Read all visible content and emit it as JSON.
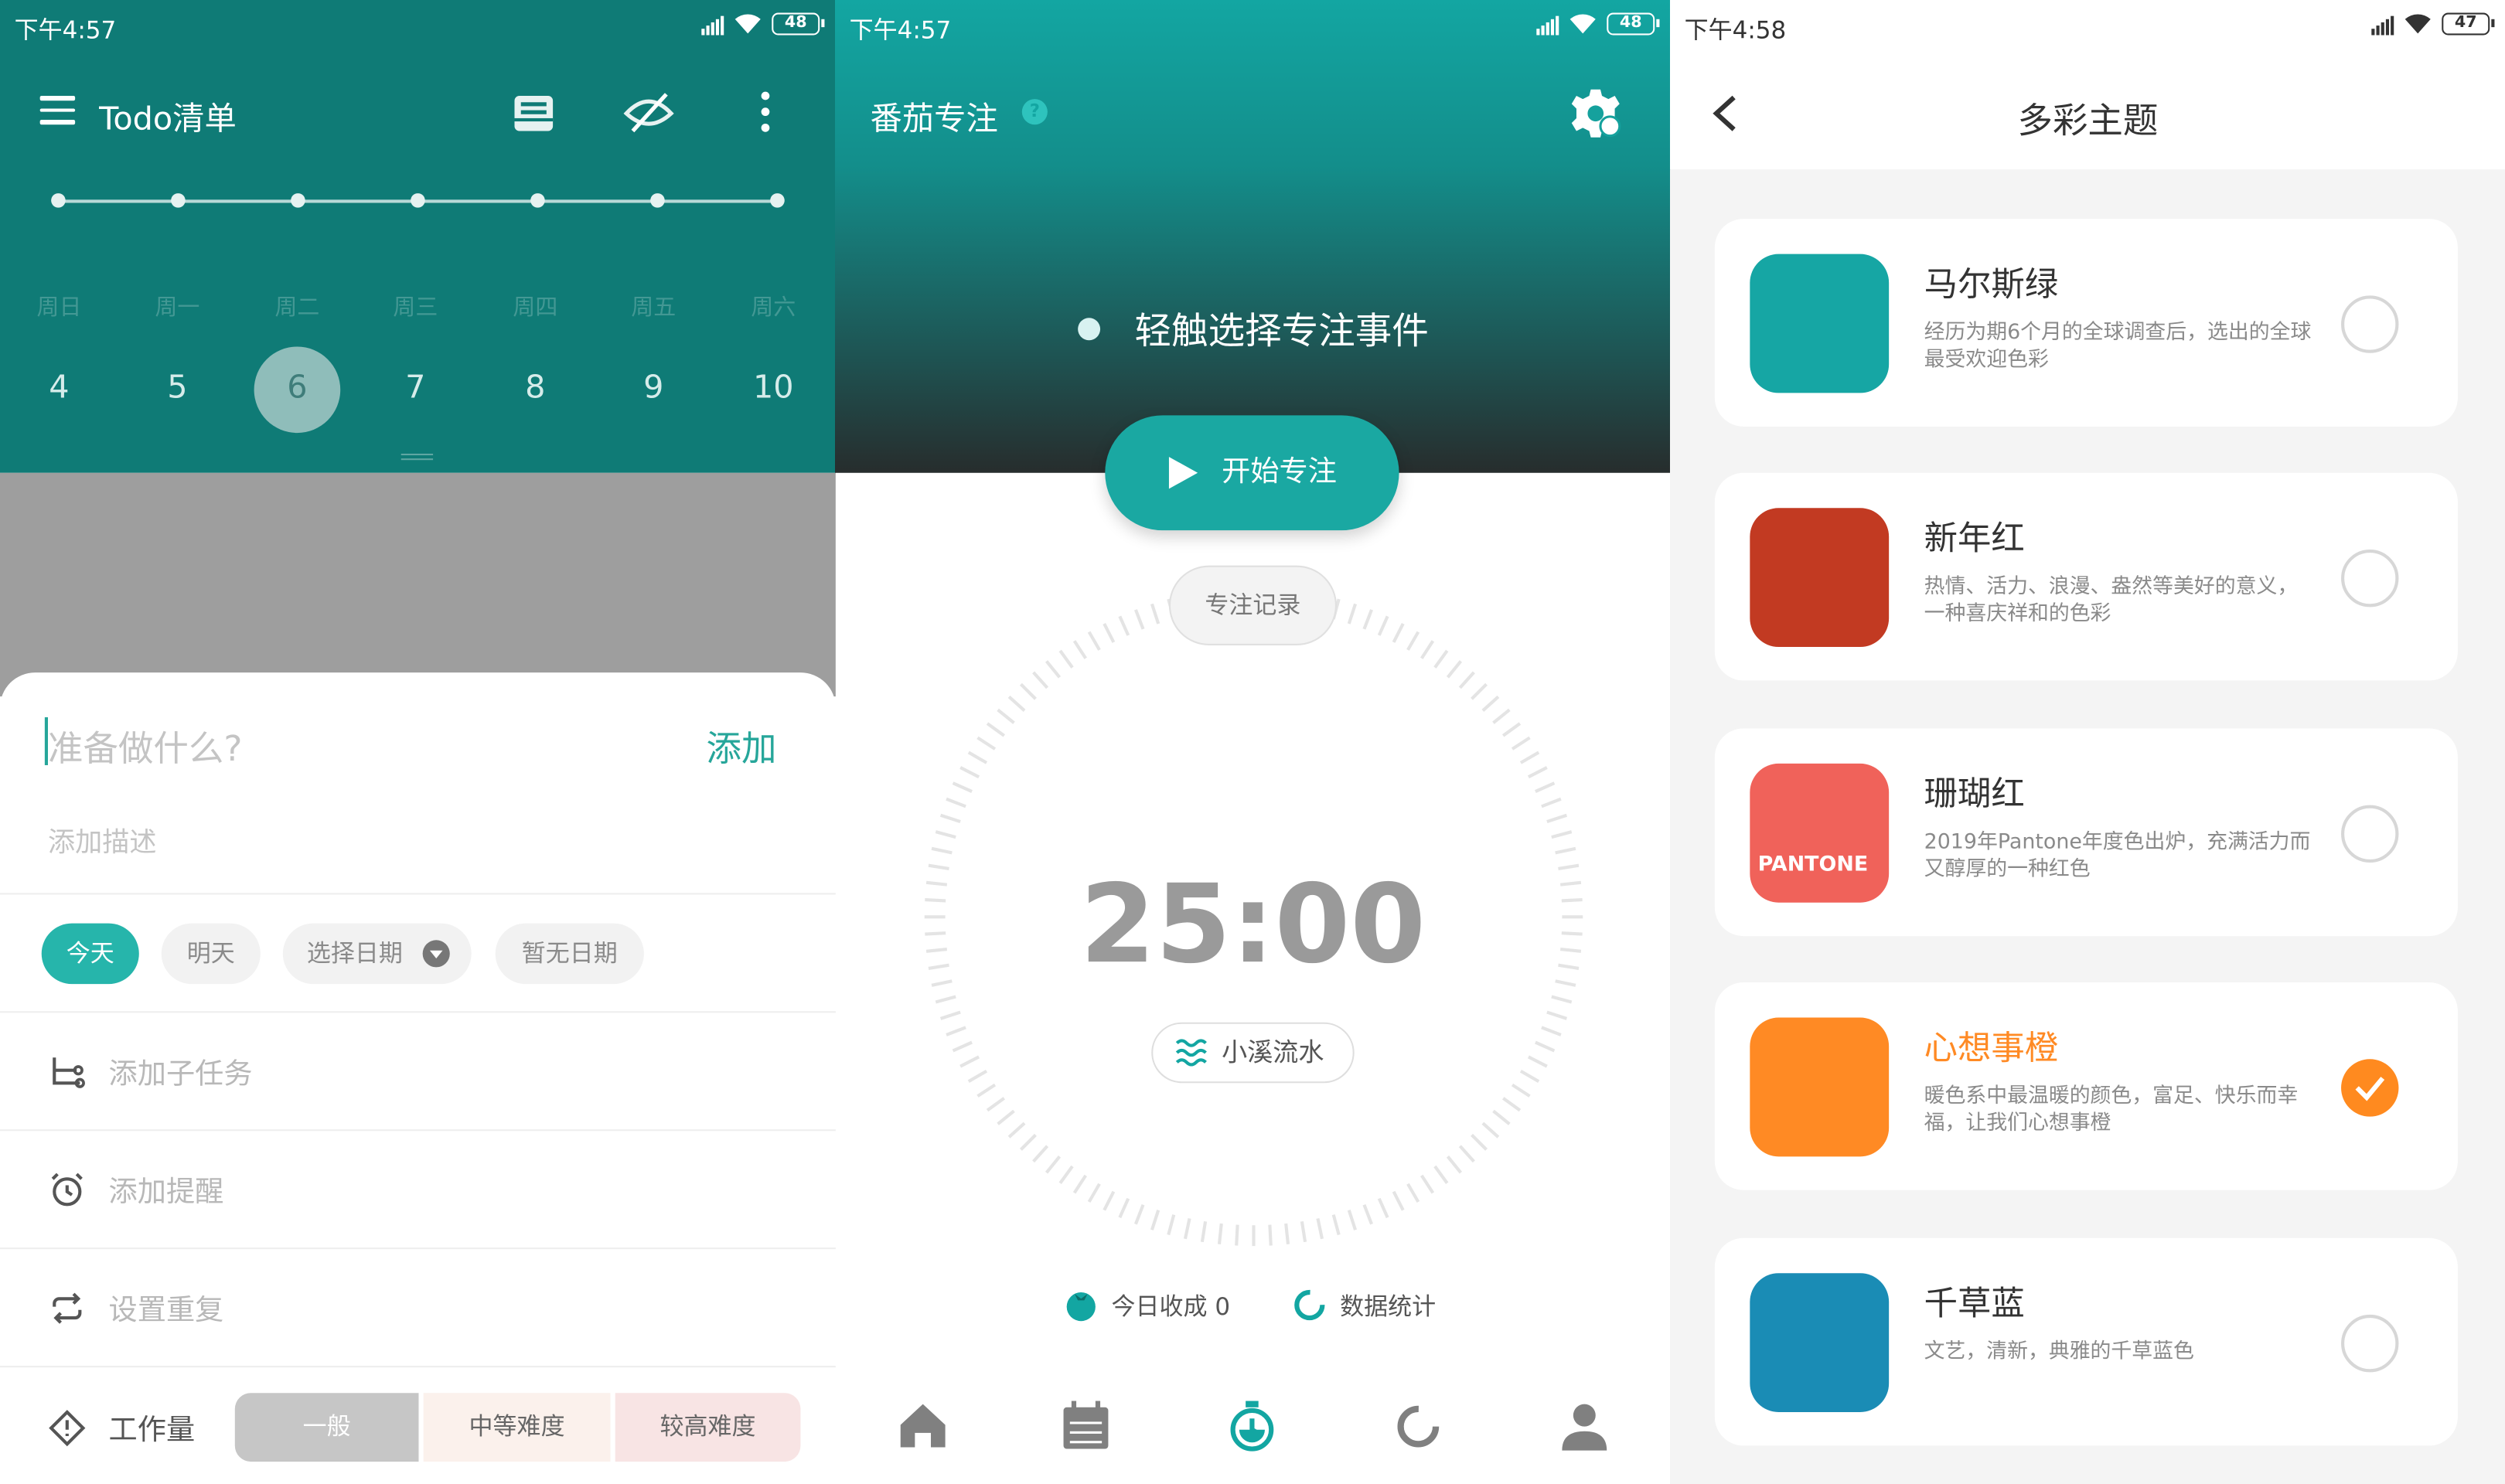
{
  "status": [
    {
      "time": "下午4:57",
      "battery": "48"
    },
    {
      "time": "下午4:57",
      "battery": "48"
    },
    {
      "time": "下午4:58",
      "battery": "47"
    }
  ],
  "todo": {
    "title": "Todo清单",
    "weekdays": [
      "周日",
      "周一",
      "周二",
      "周三",
      "周四",
      "周五",
      "周六"
    ],
    "days": [
      "4",
      "5",
      "6",
      "7",
      "8",
      "9",
      "10"
    ],
    "selected_day": "6",
    "input_placeholder": "准备做什么?",
    "add_label": "添加",
    "desc_placeholder": "添加描述",
    "date_chips": [
      "今天",
      "明天",
      "选择日期",
      "暂无日期"
    ],
    "subtask": "添加子任务",
    "reminder": "添加提醒",
    "repeat": "设置重复",
    "workload_label": "工作量",
    "workload_options": [
      "一般",
      "中等难度",
      "较高难度"
    ]
  },
  "focus": {
    "title": "番茄专注",
    "help": "?",
    "select_event": "轻触选择专注事件",
    "start": "开始专注",
    "records": "专注记录",
    "timer": "25:00",
    "sound": "小溪流水",
    "today_label": "今日收成 0",
    "stats_label": "数据统计"
  },
  "theme": {
    "title": "多彩主题",
    "items": [
      {
        "name": "马尔斯绿",
        "desc": "经历为期6个月的全球调查后，选出的全球最受欢迎色彩",
        "color": "#16a6a4",
        "badge": ""
      },
      {
        "name": "新年红",
        "desc": "热情、活力、浪漫、盎然等美好的意义，一种喜庆祥和的色彩",
        "color": "#c23a22",
        "badge": ""
      },
      {
        "name": "珊瑚红",
        "desc": "2019年Pantone年度色出炉，充满活力而又醇厚的一种红色",
        "color": "#f0625a",
        "badge": "PANTONE"
      },
      {
        "name": "心想事橙",
        "desc": "暖色系中最温暖的颜色，富足、快乐而幸福，让我们心想事橙",
        "color": "#ff8a24",
        "badge": "",
        "selected": true
      },
      {
        "name": "千草蓝",
        "desc": "文艺，清新，典雅的千草蓝色",
        "color": "#1a8cb5",
        "badge": ""
      }
    ]
  }
}
